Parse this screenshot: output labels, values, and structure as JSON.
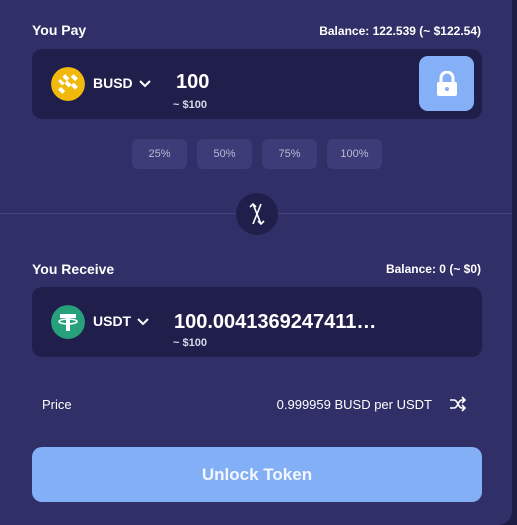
{
  "pay": {
    "label": "You Pay",
    "balance": "Balance: 122.539 (~ $122.54)",
    "token": "BUSD",
    "amount": "100",
    "usd": "~ $100",
    "token_icon": "busd-icon",
    "token_color": "#f0b90b"
  },
  "percent_buttons": [
    "25%",
    "50%",
    "75%",
    "100%"
  ],
  "receive": {
    "label": "You Receive",
    "balance": "Balance: 0 (~ $0)",
    "token": "USDT",
    "amount": "100.0041369247411…",
    "usd": "~ $100",
    "token_icon": "usdt-icon",
    "token_color": "#26a17b"
  },
  "price": {
    "label": "Price",
    "value": "0.999959 BUSD per USDT"
  },
  "unlock_button": "Unlock Token",
  "colors": {
    "card": "#312f67",
    "input_bg": "#201f4b",
    "accent": "#83aff6"
  }
}
